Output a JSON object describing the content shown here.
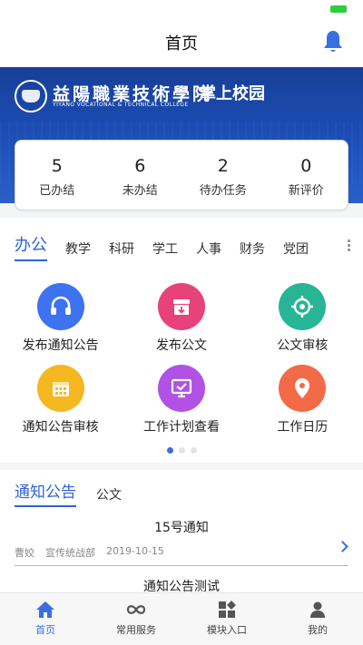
{
  "header": {
    "title": "首页"
  },
  "banner": {
    "college_name": "益陽職業技術學院",
    "college_en": "YIYANG VOCATIONAL & TECHNICAL COLLEGE",
    "app_name": "掌上校园"
  },
  "stats": [
    {
      "value": "5",
      "label": "已办结"
    },
    {
      "value": "6",
      "label": "未办结"
    },
    {
      "value": "2",
      "label": "待办任务"
    },
    {
      "value": "0",
      "label": "新评价"
    }
  ],
  "categories": [
    "办公",
    "教学",
    "科研",
    "学工",
    "人事",
    "财务",
    "党团"
  ],
  "modules": [
    {
      "label": "发布通知公告",
      "icon": "headset-icon",
      "color": "#3d72f0"
    },
    {
      "label": "发布公文",
      "icon": "inbox-download-icon",
      "color": "#e8427a"
    },
    {
      "label": "公文审核",
      "icon": "target-icon",
      "color": "#27b595"
    },
    {
      "label": "通知公告审核",
      "icon": "calendar-icon",
      "color": "#f5b821"
    },
    {
      "label": "工作计划查看",
      "icon": "monitor-check-icon",
      "color": "#b152e4"
    },
    {
      "label": "工作日历",
      "icon": "location-pin-icon",
      "color": "#f36a48"
    }
  ],
  "notices": {
    "tabs": [
      "通知公告",
      "公文"
    ],
    "items": [
      {
        "title": "15号通知",
        "author": "曹姣",
        "department": "宣传统战部",
        "date": "2019-10-15"
      },
      {
        "title": "通知公告测试"
      }
    ]
  },
  "tabbar": [
    {
      "label": "首页",
      "icon": "home-icon"
    },
    {
      "label": "常用服务",
      "icon": "infinity-icon"
    },
    {
      "label": "模块入口",
      "icon": "modules-icon"
    },
    {
      "label": "我的",
      "icon": "user-icon"
    }
  ],
  "colors": {
    "accent": "#2f63d8",
    "banner": "#1d4fb8"
  }
}
